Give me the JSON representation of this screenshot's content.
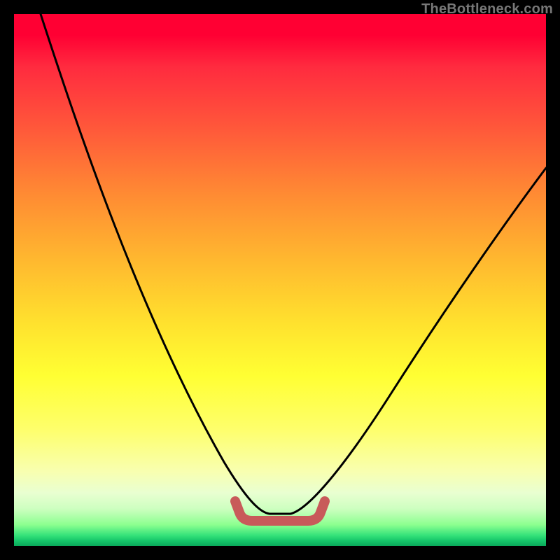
{
  "watermark": "TheBottleneck.com",
  "colors": {
    "frame": "#000000",
    "curve": "#000000",
    "bracket": "#c85a5a",
    "watermark": "#777777",
    "gradient_top": "#ff0033",
    "gradient_bottom": "#0aa95b"
  },
  "chart_data": {
    "type": "line",
    "title": "",
    "xlabel": "",
    "ylabel": "",
    "xlim": [
      0,
      100
    ],
    "ylim": [
      0,
      100
    ],
    "note": "No axis ticks or numeric labels are shown; values are relative percentages of the plot area estimated from pixel positions.",
    "series": [
      {
        "name": "bottleneck-curve",
        "x": [
          5,
          10,
          15,
          20,
          25,
          30,
          35,
          40,
          45,
          48,
          52,
          55,
          60,
          65,
          70,
          75,
          80,
          85,
          90,
          95,
          100
        ],
        "y": [
          100,
          86,
          73,
          60,
          48,
          37,
          27,
          18,
          10,
          6,
          6,
          9,
          16,
          24,
          32,
          40,
          48,
          55,
          62,
          67,
          71
        ]
      }
    ],
    "annotations": [
      {
        "name": "optimal-range-bracket",
        "x_start": 44,
        "x_end": 57,
        "y": 6,
        "description": "Thick pink bracket marking the bottom (optimal) region of the curve"
      }
    ]
  }
}
